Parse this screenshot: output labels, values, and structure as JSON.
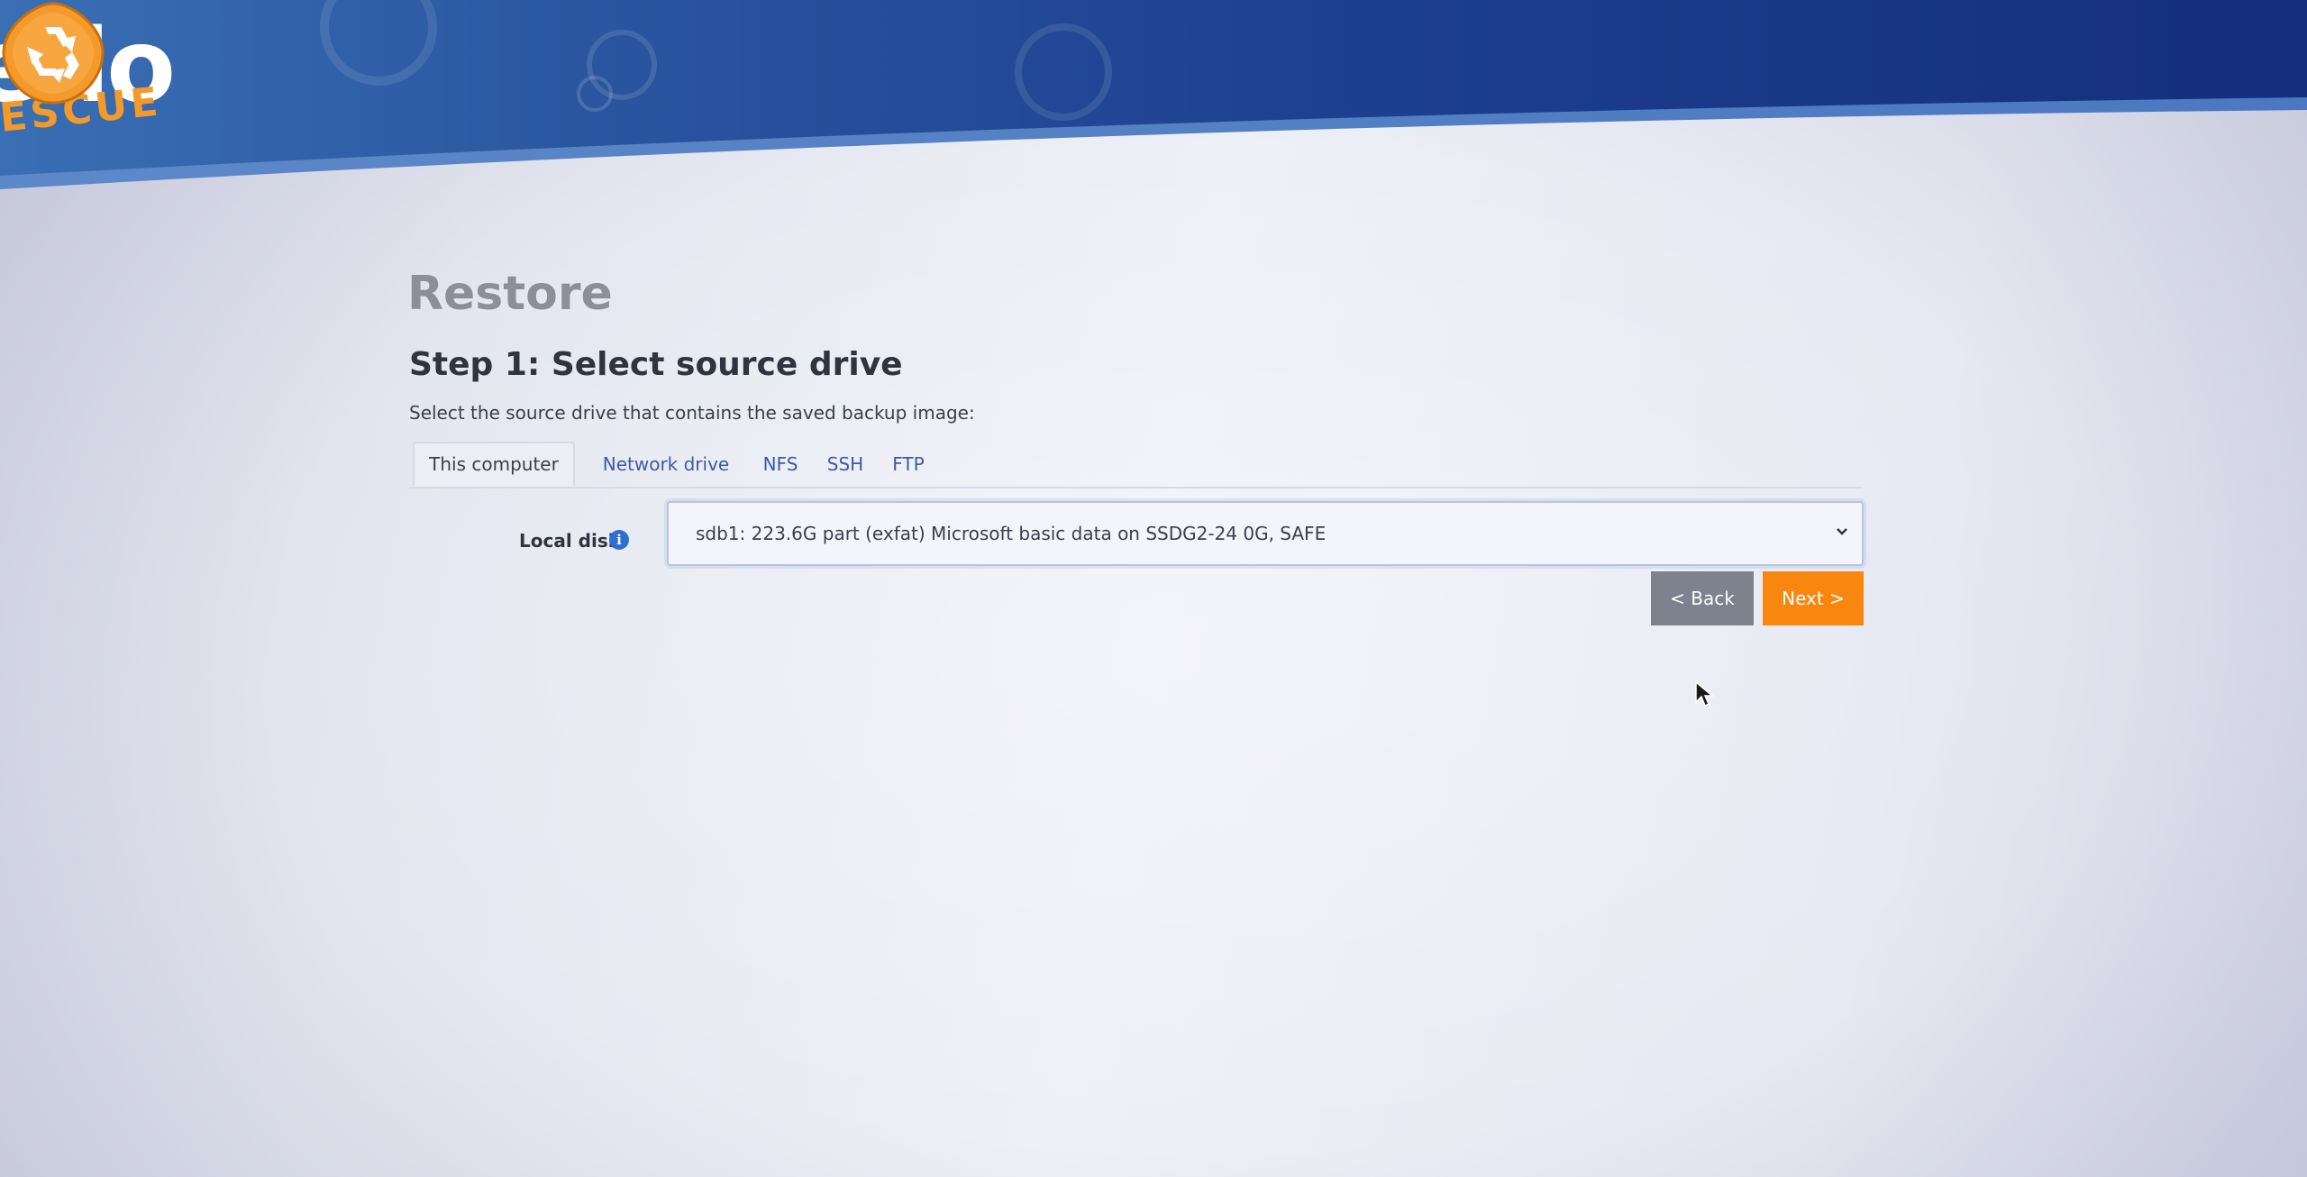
{
  "logo": {
    "text": "edo",
    "subtext": "ESCUE"
  },
  "page": {
    "title": "Restore",
    "step_title": "Step 1: Select source drive",
    "description": "Select the source drive that contains the saved backup image:"
  },
  "tabs": [
    {
      "label": "This computer",
      "active": true
    },
    {
      "label": "Network drive",
      "active": false
    },
    {
      "label": "NFS",
      "active": false
    },
    {
      "label": "SSH",
      "active": false
    },
    {
      "label": "FTP",
      "active": false
    }
  ],
  "local_disk": {
    "label": "Local disk",
    "info_icon": "info-icon",
    "selected_value": "sdb1: 223.6G part (exfat) Microsoft basic data on SSDG2-24 0G, SAFE"
  },
  "buttons": {
    "back_label": "< Back",
    "next_label": "Next >"
  },
  "colors": {
    "header_blue": "#1a3d8c",
    "accent_orange": "#f7870f",
    "back_gray": "#7d828e",
    "link_blue": "#3c5aa6"
  }
}
